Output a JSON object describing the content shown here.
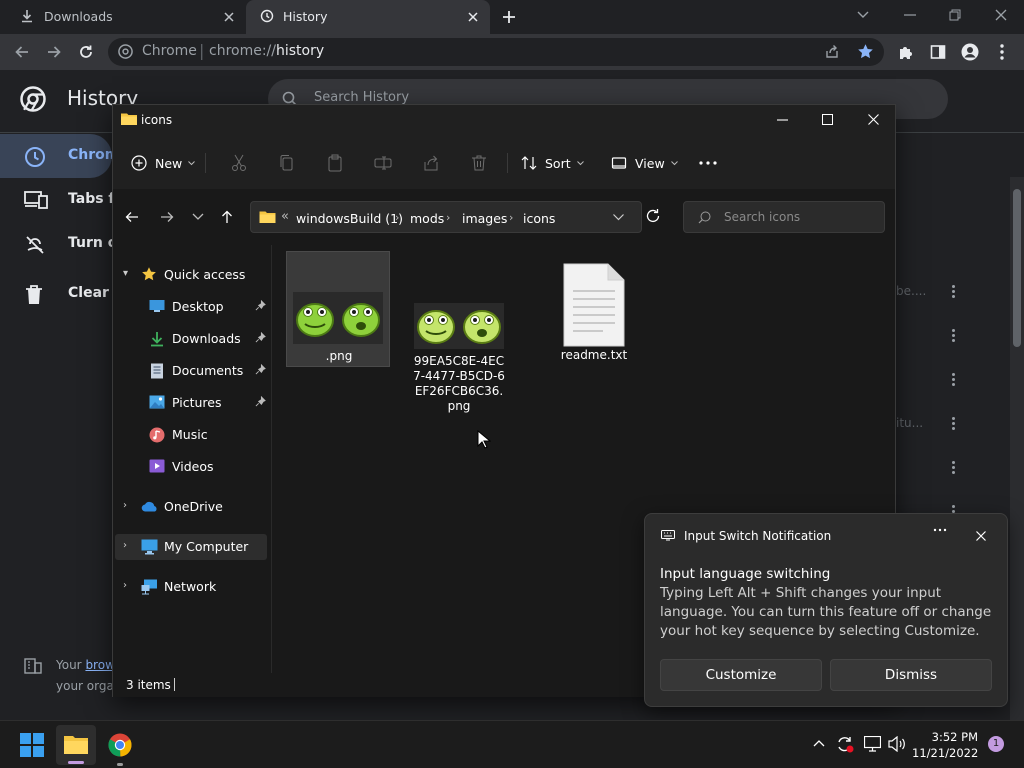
{
  "chrome": {
    "tabs": [
      {
        "label": "Downloads",
        "icon": "download-icon"
      },
      {
        "label": "History",
        "icon": "history-icon"
      }
    ],
    "omnibox": {
      "site": "Chrome",
      "url_scheme": "chrome://",
      "url_path": "history"
    }
  },
  "history_page": {
    "title": "History",
    "search_placeholder": "Search History",
    "sidebar": [
      {
        "label": "Chrome history",
        "visible": "Chrom"
      },
      {
        "label": "Tabs from other devices",
        "visible": "Tabs fr"
      },
      {
        "label": "Turn off",
        "visible": "Turn of"
      },
      {
        "label": "Clear browsing data",
        "visible": "Clear b"
      }
    ],
    "managed_text_prefix": "Your ",
    "managed_link": "brow",
    "managed_text_line2": "your orga",
    "partial_entries": [
      "be....",
      "itu..."
    ]
  },
  "explorer": {
    "title": "icons",
    "commands": {
      "new": "New",
      "sort": "Sort",
      "view": "View"
    },
    "breadcrumb": [
      "windowsBuild (1)",
      "mods",
      "images",
      "icons"
    ],
    "search_placeholder": "Search icons",
    "nav": {
      "quick_access": "Quick access",
      "desktop": "Desktop",
      "downloads": "Downloads",
      "documents": "Documents",
      "pictures": "Pictures",
      "music": "Music",
      "videos": "Videos",
      "onedrive": "OneDrive",
      "my_computer": "My Computer",
      "network": "Network"
    },
    "files": [
      {
        "name": ".png",
        "type": "image"
      },
      {
        "name": "99EA5C8E-4EC7-4477-B5CD-6EF26FCB6C36.png",
        "type": "image"
      },
      {
        "name": "readme.txt",
        "type": "text"
      }
    ],
    "status": "3 items"
  },
  "notification": {
    "app": "Input Switch Notification",
    "heading": "Input language switching",
    "body": "Typing Left Alt + Shift changes your input language. You can turn this feature off or change your hot key sequence by selecting Customize.",
    "customize": "Customize",
    "dismiss": "Dismiss"
  },
  "taskbar": {
    "time": "3:52 PM",
    "date": "11/21/2022",
    "notification_count": "1"
  },
  "colors": {
    "chrome_accent": "#8ab4f8",
    "folder_yellow": "#f4c542",
    "frog_green": "#8ed13b"
  }
}
